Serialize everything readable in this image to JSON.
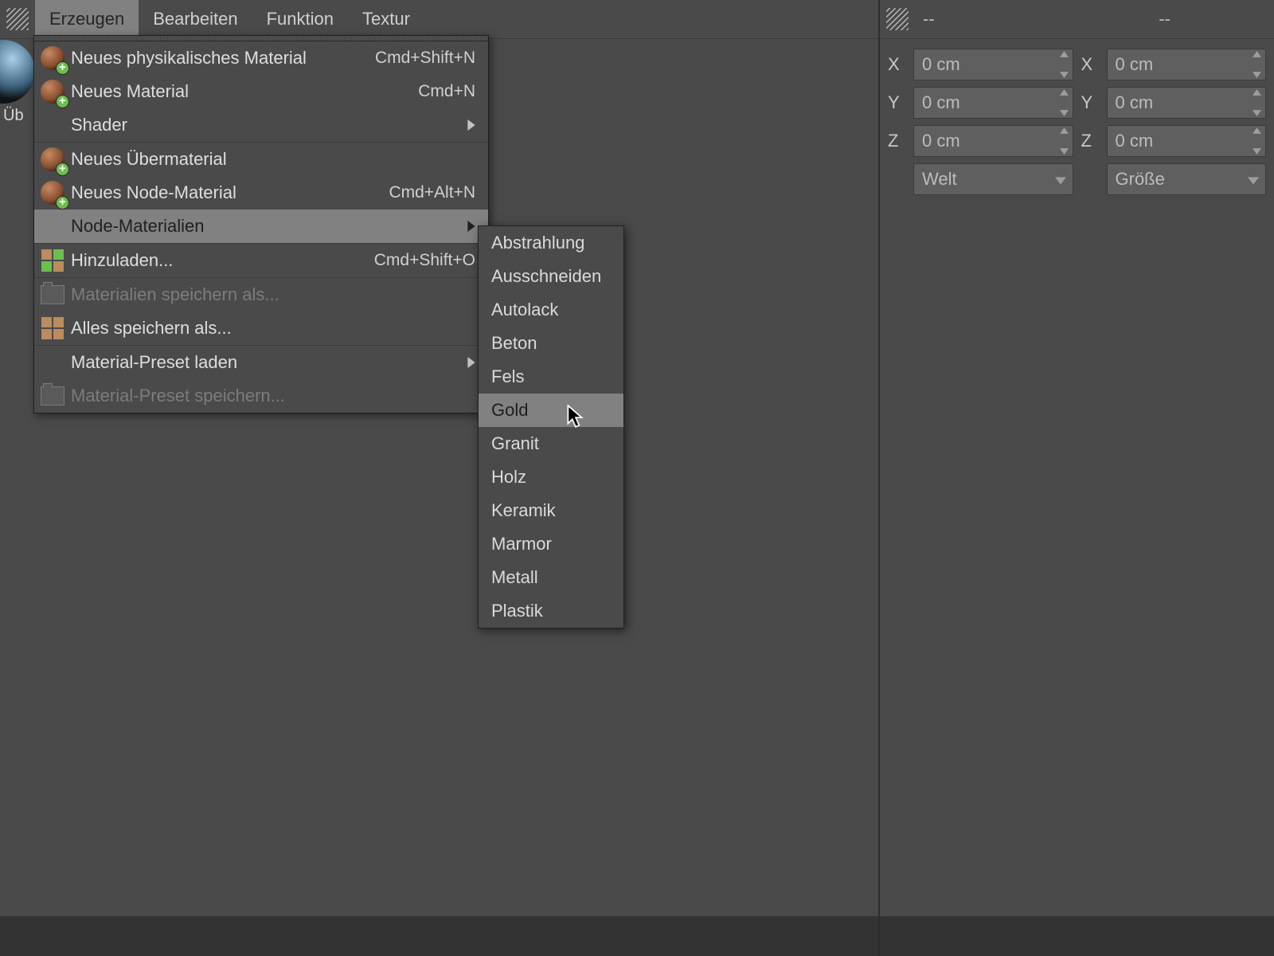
{
  "menubar": {
    "items": [
      {
        "label": "Erzeugen",
        "active": true
      },
      {
        "label": "Bearbeiten",
        "active": false
      },
      {
        "label": "Funktion",
        "active": false
      },
      {
        "label": "Textur",
        "active": false
      }
    ]
  },
  "material_thumb_label": "Üb",
  "dropdown": {
    "groups": [
      [
        {
          "label": "Neues physikalisches Material",
          "shortcut": "Cmd+Shift+N",
          "icon": "sphere-plus"
        },
        {
          "label": "Neues Material",
          "shortcut": "Cmd+N",
          "icon": "sphere-plus"
        },
        {
          "label": "Shader",
          "submenu": true
        }
      ],
      [
        {
          "label": "Neues Übermaterial",
          "icon": "sphere-plus"
        },
        {
          "label": "Neues Node-Material",
          "shortcut": "Cmd+Alt+N",
          "icon": "sphere-plus"
        },
        {
          "label": "Node-Materialien",
          "submenu": true,
          "highlight": true
        }
      ],
      [
        {
          "label": "Hinzuladen...",
          "shortcut": "Cmd+Shift+O",
          "icon": "grid-check"
        }
      ],
      [
        {
          "label": "Materialien speichern als...",
          "icon": "folder",
          "disabled": true
        },
        {
          "label": "Alles speichern als...",
          "icon": "grid"
        }
      ],
      [
        {
          "label": "Material-Preset laden",
          "submenu": true
        },
        {
          "label": "Material-Preset speichern...",
          "icon": "folder",
          "disabled": true
        }
      ]
    ]
  },
  "submenu": {
    "items": [
      "Abstrahlung",
      "Ausschneiden",
      "Autolack",
      "Beton",
      "Fels",
      "Gold",
      "Granit",
      "Holz",
      "Keramik",
      "Marmor",
      "Metall",
      "Plastik"
    ],
    "highlight_index": 5
  },
  "right_panel": {
    "header_left": "--",
    "header_right": "--",
    "rows": [
      {
        "axis1": "X",
        "value1": "0 cm",
        "axis2": "X",
        "value2": "0 cm"
      },
      {
        "axis1": "Y",
        "value1": "0 cm",
        "axis2": "Y",
        "value2": "0 cm"
      },
      {
        "axis1": "Z",
        "value1": "0 cm",
        "axis2": "Z",
        "value2": "0 cm"
      }
    ],
    "select_left": "Welt",
    "select_right": "Größe"
  }
}
